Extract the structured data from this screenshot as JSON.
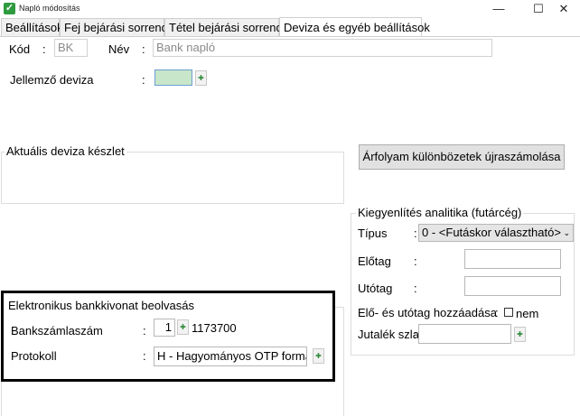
{
  "window": {
    "title": "Napló módosítás",
    "minimize": "—",
    "maximize": "☐",
    "close": "✕"
  },
  "tabs": [
    {
      "label": "Beállítások"
    },
    {
      "label": "Fej bejárási sorrend"
    },
    {
      "label": "Tétel bejárási sorrend"
    },
    {
      "label": "Deviza és egyéb beállítások"
    }
  ],
  "header": {
    "code_label": "Kód",
    "code_value": "BK",
    "name_label": "Név",
    "name_value": "Bank napló",
    "colon": ":"
  },
  "currency": {
    "label": "Jellemző deviza",
    "colon": ":",
    "value": ""
  },
  "stock": {
    "legend": "Aktuális deviza készlet"
  },
  "recalc_button": "Árfolyam különbözetek újraszámolása",
  "settlement": {
    "legend": "Kiegyenlítés analitika (futárcég)",
    "type_label": "Típus",
    "type_value": "0 - <Futáskor választható>",
    "prefix_label": "Előtag",
    "suffix_label": "Utótag",
    "add_label": "Elő- és utótag hozzáadása",
    "add_value": "nem",
    "commission_label": "Jutalék szla",
    "colon": ":"
  },
  "ebank": {
    "legend": "Elektronikus bankkivonat beolvasás",
    "account_label": "Bankszámlaszám",
    "account_value": "1",
    "account_number": "1173700",
    "protocol_label": "Protokoll",
    "protocol_value": "H - Hagyományos OTP formátum",
    "colon": ":"
  },
  "colors": {
    "accent": "#2e9b3f",
    "highlight_border": "#000000",
    "currency_field": "#c8e6c9"
  }
}
